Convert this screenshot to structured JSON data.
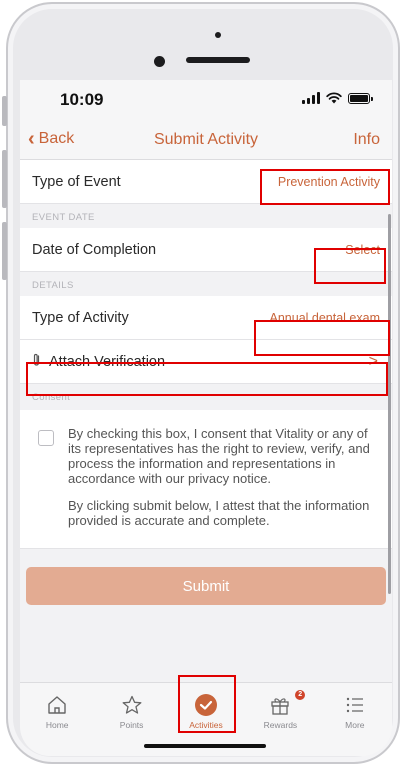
{
  "status_bar": {
    "time": "10:09"
  },
  "nav": {
    "back_label": "Back",
    "title": "Submit Activity",
    "info_label": "Info"
  },
  "form": {
    "type_of_event": {
      "label": "Type of Event",
      "value": "Prevention Activity"
    },
    "event_date_header": "EVENT DATE",
    "date_of_completion": {
      "label": "Date of Completion",
      "value": "Select"
    },
    "details_header": "DETAILS",
    "type_of_activity": {
      "label": "Type of Activity",
      "value": "Annual dental exam"
    },
    "attach_verification": {
      "label": "Attach Verification",
      "arrow": ">"
    },
    "consent_header": "Consent",
    "consent_text_1": "By checking this box, I consent that Vitality or any of its representatives has the right to review, verify, and process the information and representations in accordance with our privacy notice.",
    "consent_text_2": "By clicking submit below, I attest that the information provided is accurate and complete.",
    "submit_label": "Submit"
  },
  "tabs": [
    {
      "label": "Home",
      "icon": "home-icon"
    },
    {
      "label": "Points",
      "icon": "star-icon"
    },
    {
      "label": "Activities",
      "icon": "check-circle-icon",
      "active": true
    },
    {
      "label": "Rewards",
      "icon": "gift-icon",
      "badge": "2"
    },
    {
      "label": "More",
      "icon": "list-icon"
    }
  ],
  "colors": {
    "accent": "#c8643a",
    "submit_bg": "#e3ab92",
    "highlight": "#e00000"
  }
}
